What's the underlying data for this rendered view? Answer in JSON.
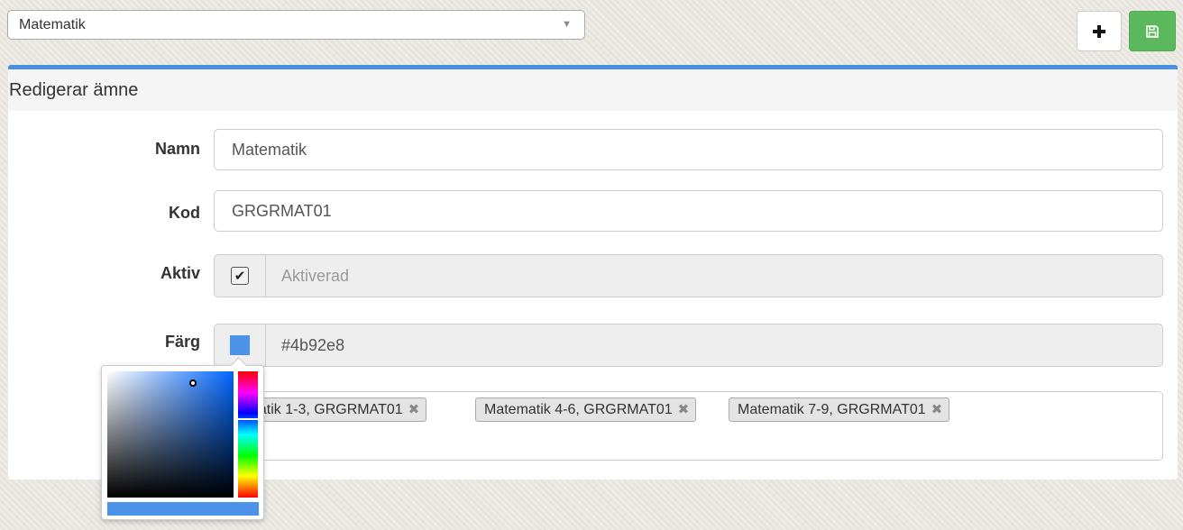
{
  "top": {
    "subject_select_value": "Matematik",
    "add_icon": "plus-icon",
    "save_icon": "floppy-disk-icon"
  },
  "panel": {
    "heading": "Redigerar ämne",
    "fields": {
      "name_label": "Namn",
      "name_value": "Matematik",
      "code_label": "Kod",
      "code_value": "GRGRMAT01",
      "active_label": "Aktiv",
      "active_checked": true,
      "active_text": "Aktiverad",
      "color_label": "Färg",
      "color_value": "#4b92e8"
    },
    "tags": [
      {
        "label": "Matematik 1-3, GRGRMAT01",
        "remove": "✖"
      },
      {
        "label": "Matematik 4-6, GRGRMAT01",
        "remove": "✖"
      },
      {
        "label": "Matematik 7-9, GRGRMAT01",
        "remove": "✖"
      }
    ]
  },
  "colors": {
    "accent": "#4a90e2",
    "save_green": "#5cb85c",
    "swatch": "#4b92e8"
  }
}
